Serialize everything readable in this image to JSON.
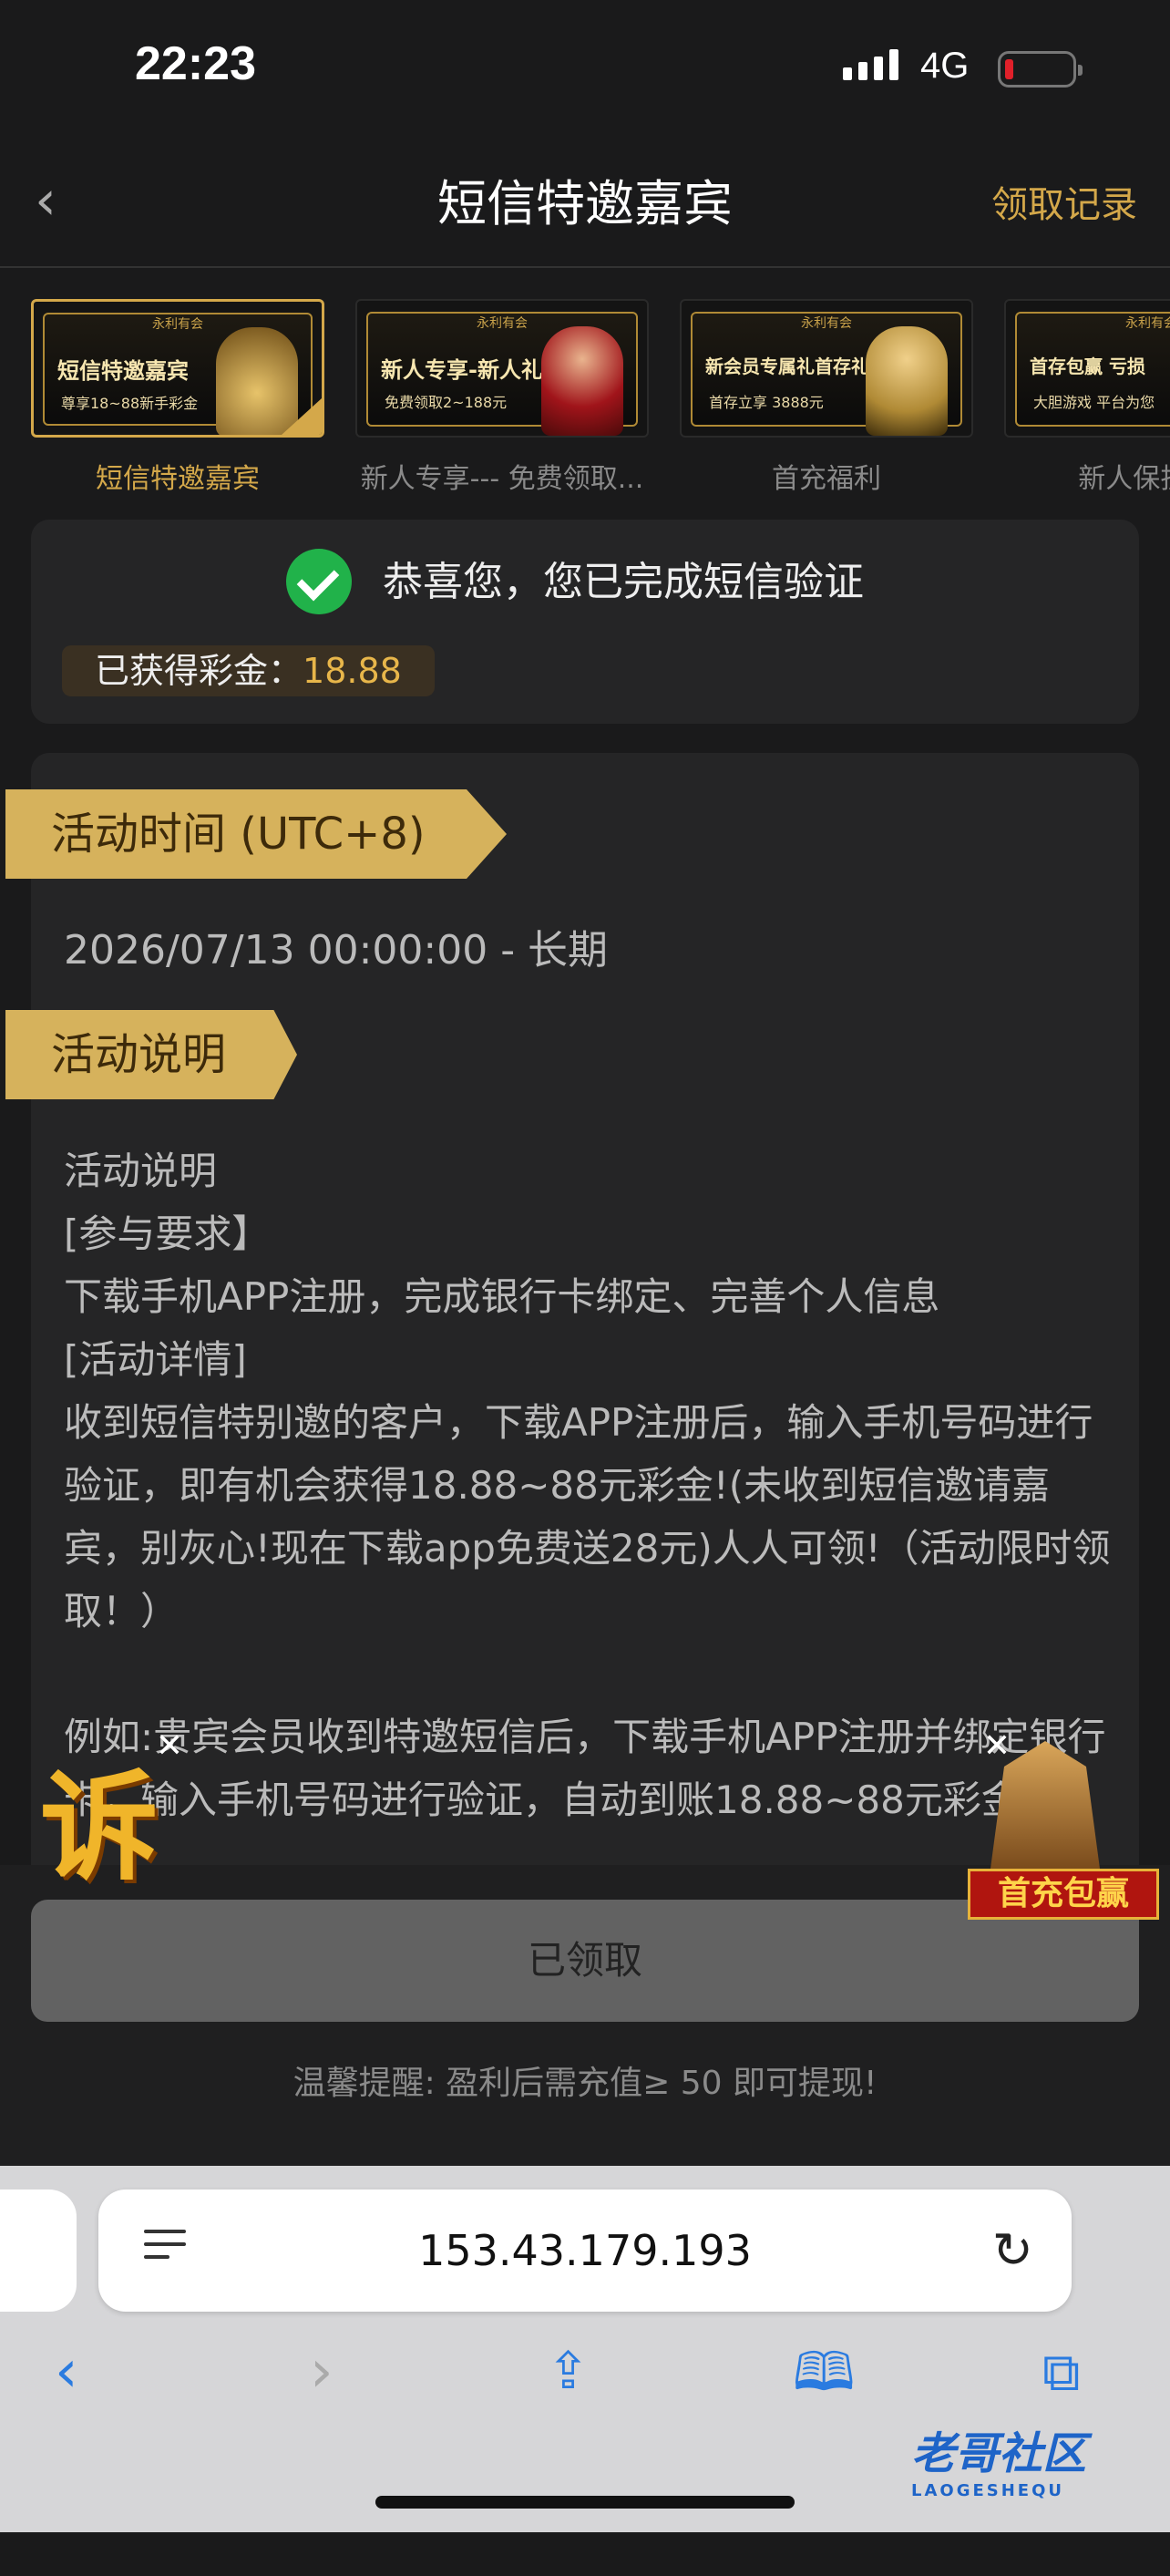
{
  "status_bar": {
    "time": "22:23",
    "network": "4G"
  },
  "nav": {
    "title": "短信特邀嘉宾",
    "record_link": "领取记录"
  },
  "tabs": [
    {
      "label": "短信特邀嘉宾",
      "banner_title": "短信特邀嘉宾",
      "banner_sub": "尊享18~88新手彩金",
      "banner_head": "永利有会",
      "active": true
    },
    {
      "label": "新人专享--- 免费领取...",
      "banner_title": "新人专享-新人礼",
      "banner_sub": "免费领取2~188元",
      "banner_head": "永利有会",
      "active": false
    },
    {
      "label": "首充福利",
      "banner_title": "新会员专属礼首存礼",
      "banner_sub": "首存立享 3888元",
      "banner_head": "永利有会",
      "active": false
    },
    {
      "label": "新人保护 首",
      "banner_title": "首存包赢 亏损",
      "banner_sub": "大胆游戏 平台为您",
      "banner_head": "永利有会",
      "active": false
    }
  ],
  "verify": {
    "message": "恭喜您，您已完成短信验证",
    "bonus_label": "已获得彩金：",
    "bonus_value": "18.88"
  },
  "activity": {
    "time_heading": "活动时间 (UTC+8)",
    "period": "2026/07/13 00:00:00 - 长期",
    "desc_heading": "活动说明",
    "desc_text": "活动说明\n[参与要求】\n下载手机APP注册，完成银行卡绑定、完善个人信息\n[活动详情]\n收到短信特别邀的客户，下载APP注册后，输入手机号码进行验证，即有机会获得18.88~88元彩金!(未收到短信邀请嘉宾，别灰心!现在下载app免费送28元)人人可领!（活动限时领取！）\n\n例如:贵宾会员收到特邀短信后，下载手机APP注册并绑定银行卡，输入手机号码进行验证，自动到账18.88~88元彩金!"
  },
  "floating": {
    "left_char": "诉",
    "right_badge": "首充包赢"
  },
  "bottom": {
    "button": "已领取",
    "tip": "温馨提醒: 盈利后需充值≥ 50 即可提现!"
  },
  "browser": {
    "url": "153.43.179.193"
  },
  "watermark": {
    "text": "老哥社区",
    "sub": "LAOGESHEQU"
  }
}
